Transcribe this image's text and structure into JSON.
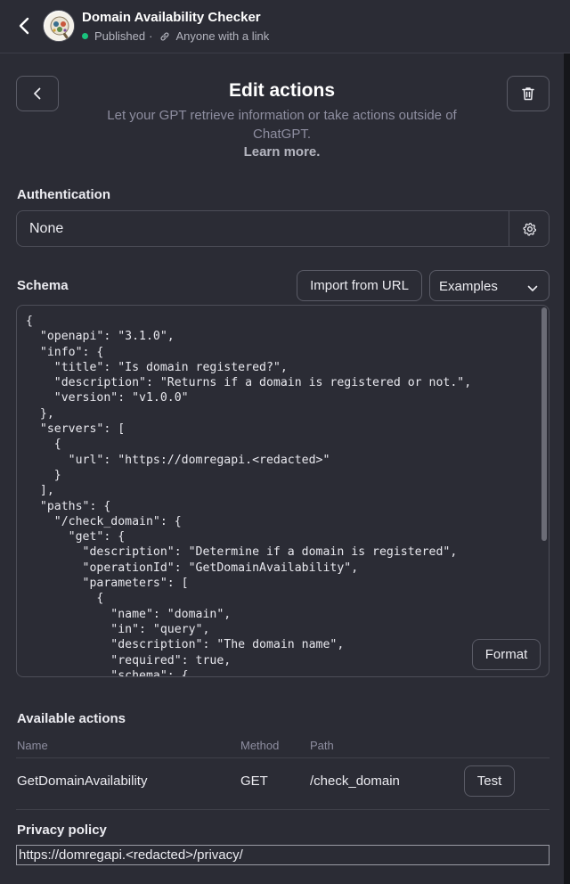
{
  "header": {
    "gpt_name": "Domain Availability Checker",
    "status": "Published",
    "separator": "·",
    "visibility": "Anyone with a link"
  },
  "editor": {
    "title": "Edit actions",
    "description": "Let your GPT retrieve information or take actions outside of ChatGPT.",
    "learn_more": "Learn more."
  },
  "authentication": {
    "label": "Authentication",
    "value": "None"
  },
  "schema": {
    "label": "Schema",
    "import_button": "Import from URL",
    "examples_label": "Examples",
    "format_button": "Format",
    "code": "{\n  \"openapi\": \"3.1.0\",\n  \"info\": {\n    \"title\": \"Is domain registered?\",\n    \"description\": \"Returns if a domain is registered or not.\",\n    \"version\": \"v1.0.0\"\n  },\n  \"servers\": [\n    {\n      \"url\": \"https://domregapi.<redacted>\"\n    }\n  ],\n  \"paths\": {\n    \"/check_domain\": {\n      \"get\": {\n        \"description\": \"Determine if a domain is registered\",\n        \"operationId\": \"GetDomainAvailability\",\n        \"parameters\": [\n          {\n            \"name\": \"domain\",\n            \"in\": \"query\",\n            \"description\": \"The domain name\",\n            \"required\": true,\n            \"schema\": {"
  },
  "actions": {
    "label": "Available actions",
    "columns": {
      "name": "Name",
      "method": "Method",
      "path": "Path"
    },
    "rows": [
      {
        "name": "GetDomainAvailability",
        "method": "GET",
        "path": "/check_domain",
        "test_label": "Test"
      }
    ]
  },
  "privacy": {
    "label": "Privacy policy",
    "value": "https://domregapi.<redacted>/privacy/"
  },
  "colors": {
    "background": "#2b2c35",
    "published_dot": "#19c37d",
    "muted_text": "#8e8ea0"
  }
}
